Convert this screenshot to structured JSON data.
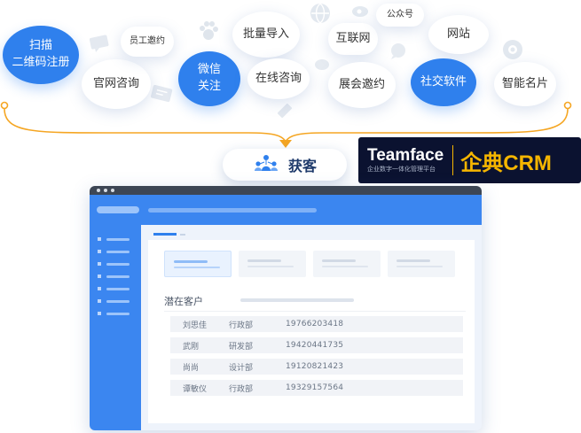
{
  "bubbles": [
    {
      "id": "scan",
      "label": "扫描\n二维码注册"
    },
    {
      "id": "website-consult",
      "label": "官网咨询"
    },
    {
      "id": "employee-invite",
      "label": "员工邀约"
    },
    {
      "id": "wechat",
      "label": "微信\n关注"
    },
    {
      "id": "batch-import",
      "label": "批量导入"
    },
    {
      "id": "online-consult",
      "label": "在线咨询"
    },
    {
      "id": "internet",
      "label": "互联网"
    },
    {
      "id": "expo-invite",
      "label": "展会邀约"
    },
    {
      "id": "official-account",
      "label": "公众号"
    },
    {
      "id": "site",
      "label": "网站"
    },
    {
      "id": "social-software",
      "label": "社交软件"
    },
    {
      "id": "smart-card",
      "label": "智能名片"
    }
  ],
  "center": {
    "label": "获客",
    "icon": "people-network-icon"
  },
  "brand": {
    "name": "Teamface",
    "tagline": "企业数字一体化管理平台",
    "product": "企典CRM"
  },
  "crm": {
    "section_title": "潜在客户",
    "rows": [
      {
        "name": "刘思佳",
        "dept": "行政部",
        "phone": "19766203418"
      },
      {
        "name": "武刚",
        "dept": "研发部",
        "phone": "19420441735"
      },
      {
        "name": "尚尚",
        "dept": "设计部",
        "phone": "19120821423"
      },
      {
        "name": "谭敏仪",
        "dept": "行政部",
        "phone": "19329157564"
      }
    ]
  },
  "colors": {
    "accent": "#2f80ed",
    "curve": "#f5a623",
    "brand_bg": "#0b1230",
    "brand_accent": "#f5b500"
  }
}
